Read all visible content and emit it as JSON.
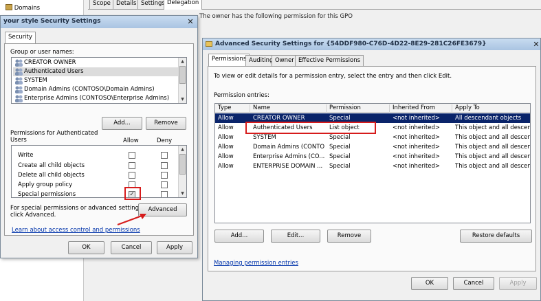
{
  "background": {
    "tree_item": "Domains",
    "tabs": [
      "Scope",
      "Details",
      "Settings",
      "Delegation"
    ],
    "partial_text": "The owner has the following permission for this GPO"
  },
  "left_dialog": {
    "title": "your style Security Settings",
    "tab": "Security",
    "group_label": "Group or user names:",
    "users": [
      "CREATOR OWNER",
      "Authenticated Users",
      "SYSTEM",
      "Domain Admins (CONTOSO\\Domain Admins)",
      "Enterprise Admins (CONTOSO\\Enterprise Admins)"
    ],
    "add_button": "Add...",
    "remove_button": "Remove",
    "perm_label_line1": "Permissions for Authenticated",
    "perm_label_line2": "Users",
    "allow_header": "Allow",
    "deny_header": "Deny",
    "permissions": [
      {
        "name": "Write",
        "allow": false,
        "deny": false
      },
      {
        "name": "Create all child objects",
        "allow": false,
        "deny": false
      },
      {
        "name": "Delete all child objects",
        "allow": false,
        "deny": false
      },
      {
        "name": "Apply group policy",
        "allow": false,
        "deny": false
      },
      {
        "name": "Special permissions",
        "allow": true,
        "deny": false
      }
    ],
    "special_text_line1": "For special permissions or advanced settings,",
    "special_text_line2": "click Advanced.",
    "advanced_button": "Advanced",
    "learn_link": "Learn about access control and permissions",
    "ok_button": "OK",
    "cancel_button": "Cancel",
    "apply_button": "Apply"
  },
  "right_dialog": {
    "title": "Advanced Security Settings for {54DDF980-C76D-4D22-8E29-281C26FE3679}",
    "tabs": [
      "Permissions",
      "Auditing",
      "Owner",
      "Effective Permissions"
    ],
    "instruction": "To view or edit details for a permission entry, select the entry and then click Edit.",
    "entries_label": "Permission entries:",
    "columns": [
      "Type",
      "Name",
      "Permission",
      "Inherited From",
      "Apply To"
    ],
    "rows": [
      [
        "Allow",
        "CREATOR OWNER",
        "Special",
        "<not inherited>",
        "All descendant objects"
      ],
      [
        "Allow",
        "Authenticated Users",
        "List object",
        "<not inherited>",
        "This object and all descen..."
      ],
      [
        "Allow",
        "SYSTEM",
        "Special",
        "<not inherited>",
        "This object and all descen..."
      ],
      [
        "Allow",
        "Domain Admins (CONTO...",
        "Special",
        "<not inherited>",
        "This object and all descen..."
      ],
      [
        "Allow",
        "Enterprise Admins (CO...",
        "Special",
        "<not inherited>",
        "This object and all descen..."
      ],
      [
        "Allow",
        "ENTERPRISE DOMAIN ...",
        "Special",
        "<not inherited>",
        "This object and all descen..."
      ]
    ],
    "add_button": "Add...",
    "edit_button": "Edit...",
    "remove_button": "Remove",
    "restore_button": "Restore defaults",
    "manage_link": "Managing permission entries",
    "ok_button": "OK",
    "cancel_button": "Cancel",
    "apply_button": "Apply"
  },
  "colors": {
    "selection": "#0a246a",
    "highlight_box": "#d61b1b",
    "title_bar": "#b9d1ea"
  }
}
